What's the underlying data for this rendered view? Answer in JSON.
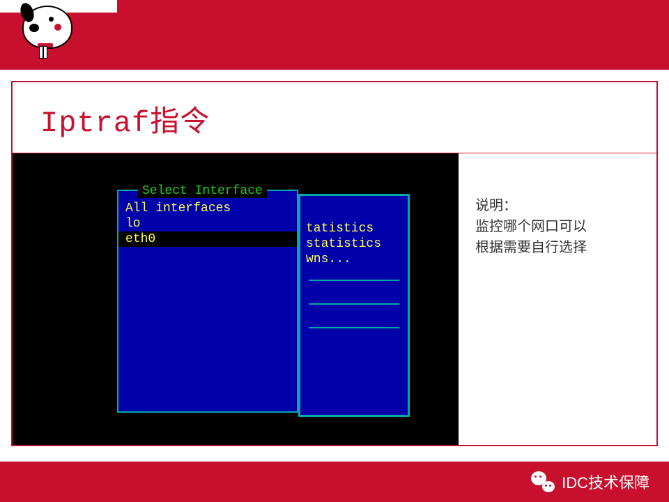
{
  "title": "Iptraf指令",
  "tui": {
    "heading": "Select Interface",
    "items": [
      {
        "label": "All interfaces",
        "selected": false
      },
      {
        "label": "lo",
        "selected": false
      },
      {
        "label": "eth0",
        "selected": true
      }
    ],
    "back_items": [
      "tatistics",
      "statistics",
      "wns..."
    ]
  },
  "notes": {
    "heading": "说明：",
    "line1": "监控哪个网口可以",
    "line2": "根据需要自行选择"
  },
  "footer": "IDC技术保障"
}
